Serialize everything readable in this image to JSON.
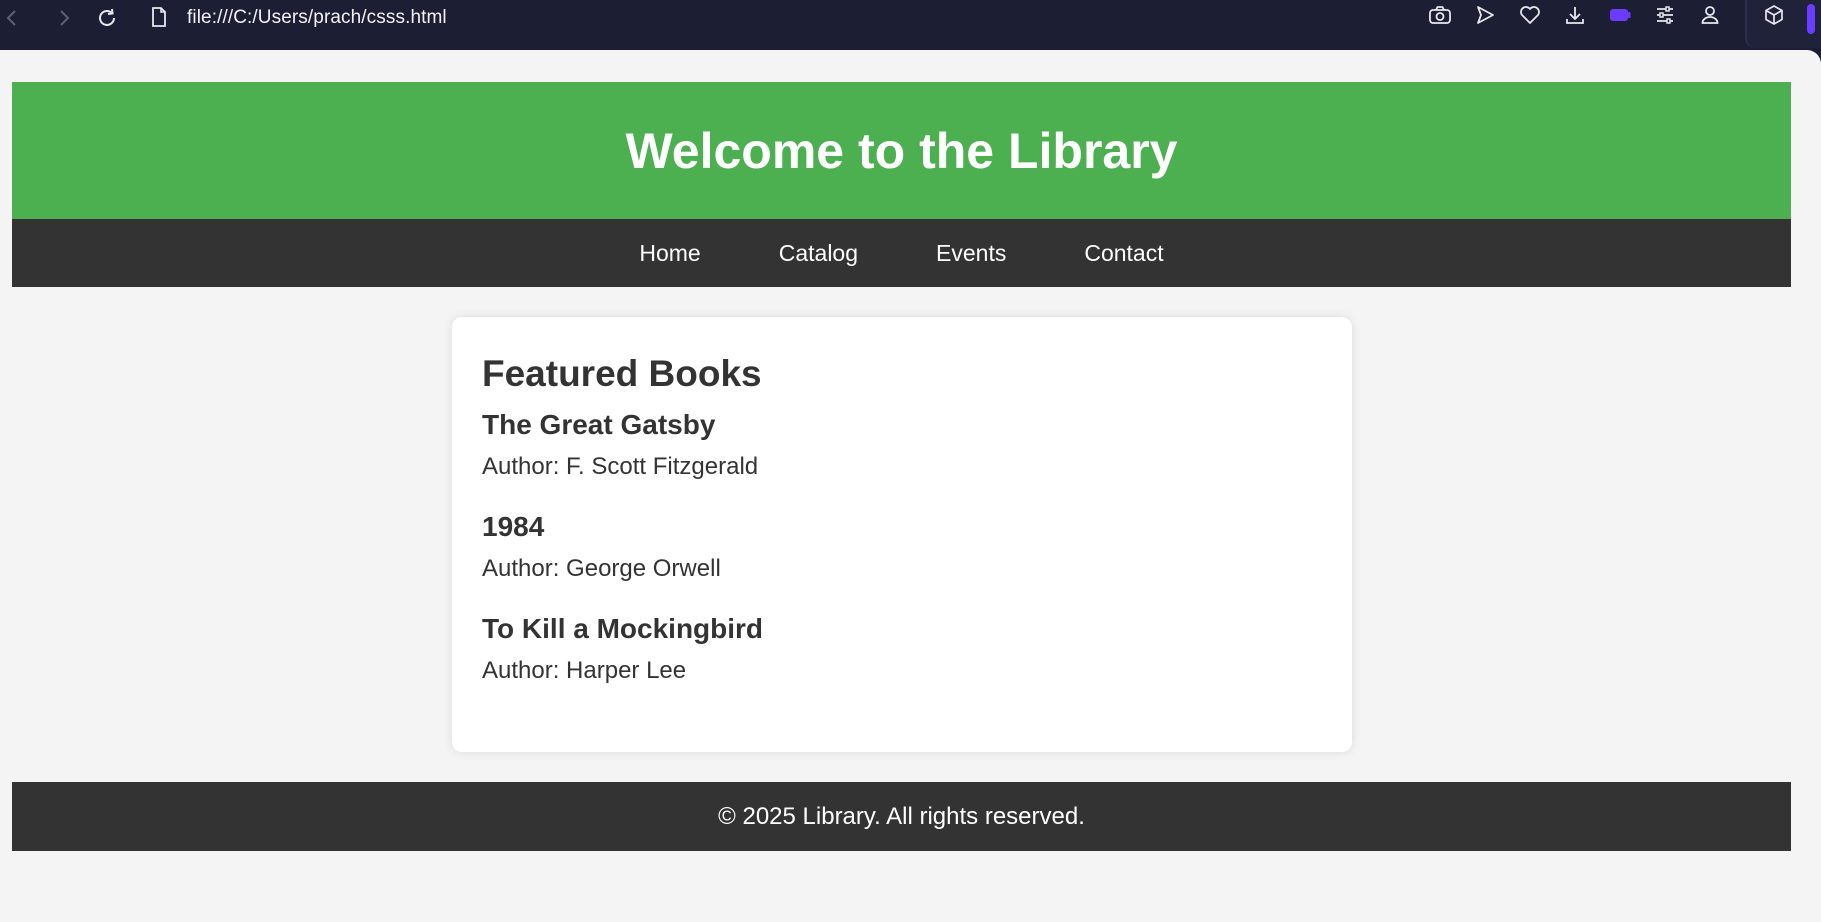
{
  "browser": {
    "url": "file:///C:/Users/prach/csss.html",
    "toolbar_icons": [
      "camera-icon",
      "send-icon",
      "heart-icon",
      "download-icon",
      "battery-icon",
      "sliders-icon",
      "profile-icon",
      "cube-icon"
    ],
    "accent_color": "#6b3cff"
  },
  "page": {
    "header_title": "Welcome to the Library",
    "header_color": "#4caf50",
    "nav_items": [
      {
        "label": "Home"
      },
      {
        "label": "Catalog"
      },
      {
        "label": "Events"
      },
      {
        "label": "Contact"
      }
    ],
    "featured": {
      "title": "Featured Books",
      "books": [
        {
          "title": "The Great Gatsby",
          "author": "Author: F. Scott Fitzgerald"
        },
        {
          "title": "1984",
          "author": "Author: George Orwell"
        },
        {
          "title": "To Kill a Mockingbird",
          "author": "Author: Harper Lee"
        }
      ]
    },
    "footer_text": "© 2025 Library. All rights reserved."
  }
}
